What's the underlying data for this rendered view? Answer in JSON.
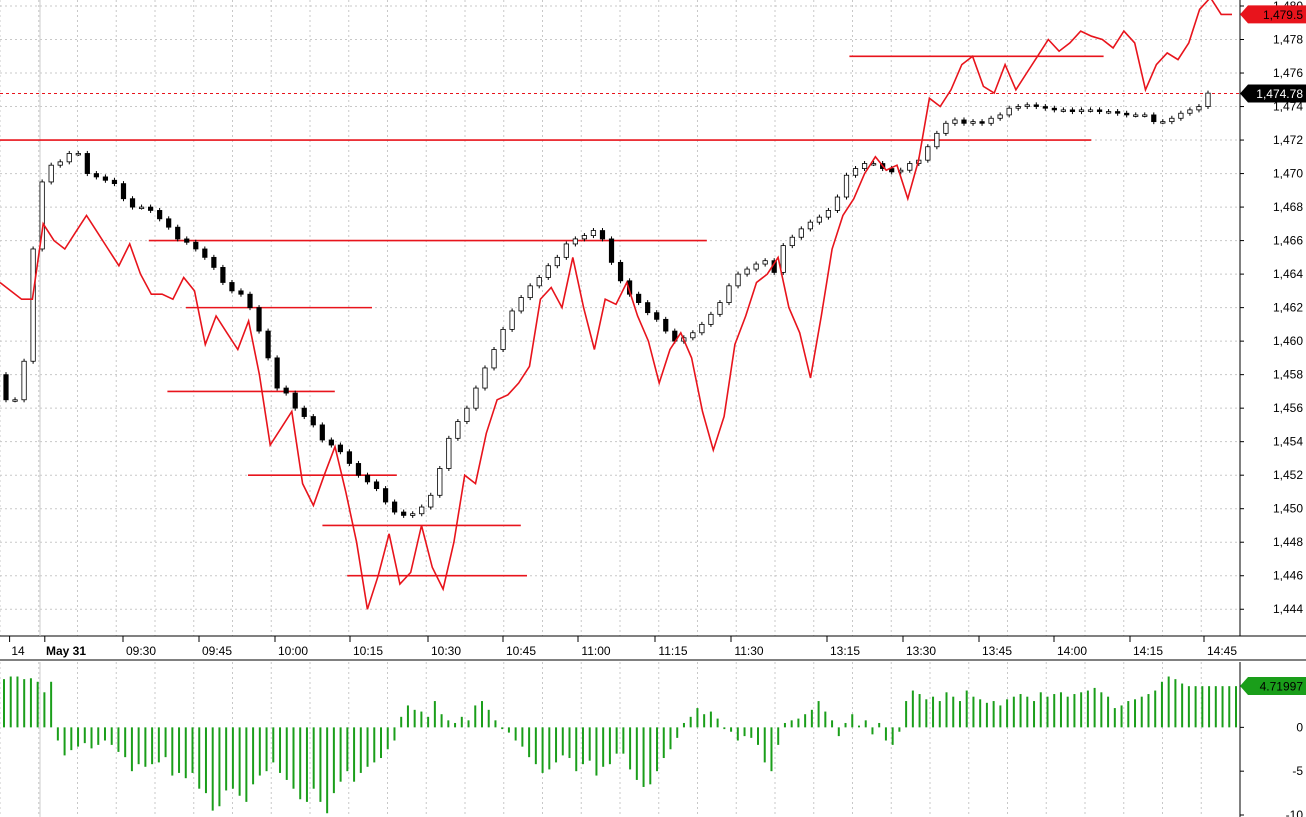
{
  "chart_data": [
    {
      "panel": "price",
      "type": "candlestick+line",
      "y_axis_side": "right",
      "ylim": [
        1443,
        1480
      ],
      "y_ticks": [
        1444,
        1446,
        1448,
        1450,
        1452,
        1454,
        1456,
        1458,
        1460,
        1462,
        1464,
        1466,
        1468,
        1470,
        1472,
        1474,
        1476,
        1478,
        1480
      ],
      "y_tick_labels": [
        "1,444",
        "1,446",
        "1,448",
        "1,450",
        "1,452",
        "1,454",
        "1,456",
        "1,458",
        "1,460",
        "1,462",
        "1,464",
        "1,466",
        "1,468",
        "1,470",
        "1,472",
        "1,474",
        "1,476",
        "1,478",
        "1,480"
      ],
      "x_time_labels": [
        "14",
        "May 31",
        "09:30",
        "09:45",
        "10:00",
        "10:15",
        "10:30",
        "10:45",
        "11:00",
        "11:15",
        "11:30",
        "13:15",
        "13:30",
        "13:45",
        "14:00",
        "14:15",
        "14:45"
      ],
      "grid": true,
      "candle_close_path": [
        1456.5,
        1456.5,
        1458.8,
        1465.5,
        1469.5,
        1470.5,
        1470.7,
        1471.2,
        1471.2,
        1470.0,
        1469.8,
        1469.6,
        1469.4,
        1468.5,
        1468.0,
        1468.0,
        1467.8,
        1467.3,
        1466.8,
        1466.1,
        1465.9,
        1465.5,
        1465.0,
        1464.4,
        1463.5,
        1463.0,
        1462.8,
        1462.0,
        1460.6,
        1459.0,
        1457.2,
        1456.9,
        1456.0,
        1455.5,
        1455.0,
        1454.1,
        1453.8,
        1453.4,
        1452.7,
        1452.0,
        1451.6,
        1451.2,
        1450.4,
        1449.8,
        1449.6,
        1449.7,
        1450.1,
        1450.8,
        1452.4,
        1454.2,
        1455.2,
        1456.0,
        1457.2,
        1458.4,
        1459.5,
        1460.7,
        1461.8,
        1462.6,
        1463.3,
        1463.8,
        1464.5,
        1465.0,
        1465.8,
        1466.1,
        1466.3,
        1466.6,
        1466.1,
        1464.7,
        1463.6,
        1462.8,
        1462.3,
        1461.7,
        1461.3,
        1460.6,
        1460.0,
        1460.2,
        1460.5,
        1461.0,
        1461.6,
        1462.3,
        1463.3,
        1464.0,
        1464.3,
        1464.6,
        1464.8,
        1464.1,
        1465.7,
        1466.2,
        1466.7,
        1467.1,
        1467.4,
        1467.8,
        1468.6,
        1469.9,
        1470.3,
        1470.6,
        1470.6,
        1470.3,
        1470.1,
        1470.2,
        1470.6,
        1470.8,
        1471.6,
        1472.4,
        1473.0,
        1473.2,
        1473.0,
        1473.1,
        1473.0,
        1473.3,
        1473.5,
        1473.9,
        1474.0,
        1474.1,
        1474.0,
        1473.9,
        1473.8,
        1473.8,
        1473.7,
        1473.8,
        1473.8,
        1473.7,
        1473.7,
        1473.6,
        1473.5,
        1473.5,
        1473.5,
        1473.1,
        1473.1,
        1473.3,
        1473.6,
        1473.8,
        1474.0,
        1474.8
      ],
      "red_line_path": [
        1463.5,
        1463.0,
        1462.5,
        1462.5,
        1467.0,
        1466.0,
        1465.5,
        1466.5,
        1467.5,
        1466.5,
        1465.5,
        1464.5,
        1465.8,
        1464.0,
        1462.8,
        1462.8,
        1462.5,
        1463.8,
        1463.0,
        1459.8,
        1461.5,
        1460.5,
        1459.5,
        1461.2,
        1458.0,
        1453.8,
        1454.8,
        1455.8,
        1451.5,
        1450.2,
        1452.0,
        1453.7,
        1451.0,
        1448.0,
        1444.0,
        1446.0,
        1448.5,
        1445.5,
        1446.2,
        1449.0,
        1446.5,
        1445.2,
        1448.0,
        1452.0,
        1451.5,
        1454.5,
        1456.5,
        1456.8,
        1457.5,
        1458.5,
        1462.5,
        1463.2,
        1462.0,
        1465.0,
        1462.0,
        1459.5,
        1462.5,
        1462.2,
        1463.5,
        1461.5,
        1460.0,
        1457.5,
        1459.5,
        1460.5,
        1459.0,
        1455.8,
        1453.5,
        1455.5,
        1459.8,
        1461.5,
        1463.5,
        1464.0,
        1465.0,
        1462.0,
        1460.5,
        1457.8,
        1461.5,
        1465.5,
        1467.5,
        1468.5,
        1470.0,
        1471.0,
        1470.2,
        1470.5,
        1468.5,
        1470.8,
        1474.5,
        1474.0,
        1475.0,
        1476.5,
        1477.0,
        1475.2,
        1474.8,
        1476.5,
        1475.0,
        1476.0,
        1477.0,
        1478.0,
        1477.3,
        1477.8,
        1478.5,
        1478.2,
        1478.0,
        1477.5,
        1478.5,
        1477.8,
        1475.0,
        1476.5,
        1477.2,
        1476.8,
        1477.8,
        1479.8,
        1480.5,
        1479.5,
        1479.5
      ],
      "horizontal_levels": [
        {
          "y": 1472,
          "x_start_frac": 0.0,
          "x_end_frac": 0.88
        },
        {
          "y": 1466,
          "x_start_frac": 0.12,
          "x_end_frac": 0.57
        },
        {
          "y": 1462,
          "x_start_frac": 0.15,
          "x_end_frac": 0.3
        },
        {
          "y": 1457,
          "x_start_frac": 0.135,
          "x_end_frac": 0.27
        },
        {
          "y": 1452,
          "x_start_frac": 0.2,
          "x_end_frac": 0.32
        },
        {
          "y": 1449,
          "x_start_frac": 0.26,
          "x_end_frac": 0.42
        },
        {
          "y": 1446,
          "x_start_frac": 0.28,
          "x_end_frac": 0.425
        },
        {
          "y": 1477,
          "x_start_frac": 0.685,
          "x_end_frac": 0.89
        }
      ],
      "markers": [
        {
          "label": "1,479.5",
          "value": 1479.5,
          "color": "#e8141c",
          "text_color": "#000000"
        },
        {
          "label": "1,474.78",
          "value": 1474.78,
          "color": "#000000",
          "text_color": "#ffffff"
        }
      ],
      "dashed_level": 1474.78
    },
    {
      "panel": "oscillator",
      "type": "histogram",
      "y_axis_side": "right",
      "ylim": [
        -10,
        7
      ],
      "y_ticks": [
        0,
        -5,
        -10
      ],
      "y_tick_labels": [
        "0",
        "-5",
        "-10"
      ],
      "bar_color": "#1a9e1a",
      "values": [
        5.5,
        5.8,
        5.8,
        5.5,
        5.6,
        5.2,
        4.0,
        5.2,
        -1.5,
        -3.2,
        -2.6,
        -2.2,
        -1.8,
        -2.4,
        -2.0,
        -1.5,
        -2.0,
        -2.8,
        -3.4,
        -5.0,
        -4.2,
        -4.5,
        -4.2,
        -4.0,
        -3.4,
        -5.5,
        -5.2,
        -5.8,
        -5.2,
        -7.0,
        -7.5,
        -9.5,
        -9.0,
        -7.2,
        -7.0,
        -7.8,
        -8.5,
        -6.5,
        -5.5,
        -5.0,
        -4.0,
        -5.2,
        -6.0,
        -7.0,
        -8.2,
        -8.5,
        -7.0,
        -8.5,
        -9.8,
        -7.5,
        -6.2,
        -5.0,
        -6.2,
        -5.2,
        -4.5,
        -4.0,
        -3.5,
        -2.5,
        -1.5,
        1.2,
        2.5,
        2.0,
        1.8,
        1.2,
        3.0,
        1.5,
        0.8,
        0.5,
        1.2,
        0.8,
        2.5,
        3.0,
        2.0,
        0.8,
        -0.2,
        -0.6,
        -1.5,
        -2.2,
        -3.4,
        -4.2,
        -5.2,
        -4.8,
        -4.0,
        -3.2,
        -3.5,
        -5.0,
        -4.2,
        -3.8,
        -5.5,
        -4.5,
        -4.2,
        -3.0,
        -3.0,
        -4.8,
        -6.0,
        -6.8,
        -6.5,
        -5.0,
        -3.5,
        -2.5,
        -1.2,
        0.5,
        1.2,
        2.2,
        1.5,
        1.8,
        1.0,
        -0.2,
        -0.5,
        -1.5,
        -1.0,
        -1.2,
        -2.0,
        -4.0,
        -5.0,
        -2.0,
        0.5,
        0.8,
        1.0,
        1.5,
        2.0,
        3.0,
        1.8,
        0.8,
        -1.0,
        0.5,
        1.5,
        0.2,
        0.8,
        -0.8,
        0.5,
        -1.5,
        -2.0,
        -0.5,
        3.0,
        4.2,
        3.8,
        3.2,
        3.5,
        3.0,
        4.0,
        3.5,
        3.0,
        4.2,
        3.5,
        3.2,
        2.8,
        3.0,
        2.5,
        3.2,
        3.5,
        3.8,
        3.5,
        3.0,
        4.0,
        3.5,
        3.8,
        4.0,
        3.5,
        3.8,
        4.0,
        4.2,
        4.5,
        4.0,
        3.5,
        2.2,
        2.5,
        3.0,
        3.2,
        3.5,
        3.8,
        4.2,
        5.2,
        5.8,
        5.5,
        5.0,
        4.7,
        4.7,
        4.7,
        4.7,
        4.7,
        4.7,
        4.7,
        4.7
      ],
      "marker": {
        "label": "4.71997",
        "value": 4.71997,
        "color": "#1a9e1a",
        "text_color": "#000000"
      }
    }
  ]
}
